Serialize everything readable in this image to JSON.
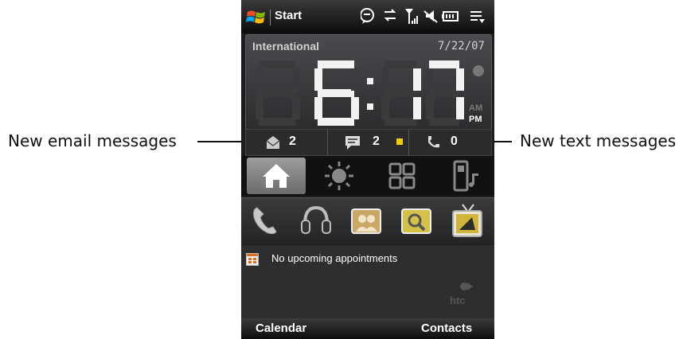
{
  "annotations": {
    "left_label": "New email messages",
    "right_label": "New text messages"
  },
  "titlebar": {
    "start_label": "Start",
    "icons": [
      "windows-flag-icon",
      "speech-bubble-icon",
      "data-transfer-icon",
      "signal-icon",
      "speaker-muted-icon",
      "battery-icon",
      "menu-icon"
    ]
  },
  "clock": {
    "city": "International",
    "date": "7/22/07",
    "time": "6:17",
    "am_label": "AM",
    "pm_label": "PM",
    "active_period": "PM"
  },
  "notifications": {
    "email_count": "2",
    "sms_count": "2",
    "missed_calls_count": "0"
  },
  "tabs": [
    {
      "name": "home-icon",
      "active": true
    },
    {
      "name": "weather-sun-icon",
      "active": false
    },
    {
      "name": "programs-grid-icon",
      "active": false
    },
    {
      "name": "music-phone-icon",
      "active": false
    }
  ],
  "quick_launch": [
    "phone-icon",
    "headset-icon",
    "people-icon",
    "search-magnifier-icon",
    "tv-icon"
  ],
  "appointments": {
    "text": "No upcoming appointments",
    "brand": "htc"
  },
  "softkeys": {
    "left": "Calendar",
    "right": "Contacts"
  },
  "colors": {
    "accent_yellow": "#f0d000",
    "background_dark": "#1c1d1f"
  }
}
